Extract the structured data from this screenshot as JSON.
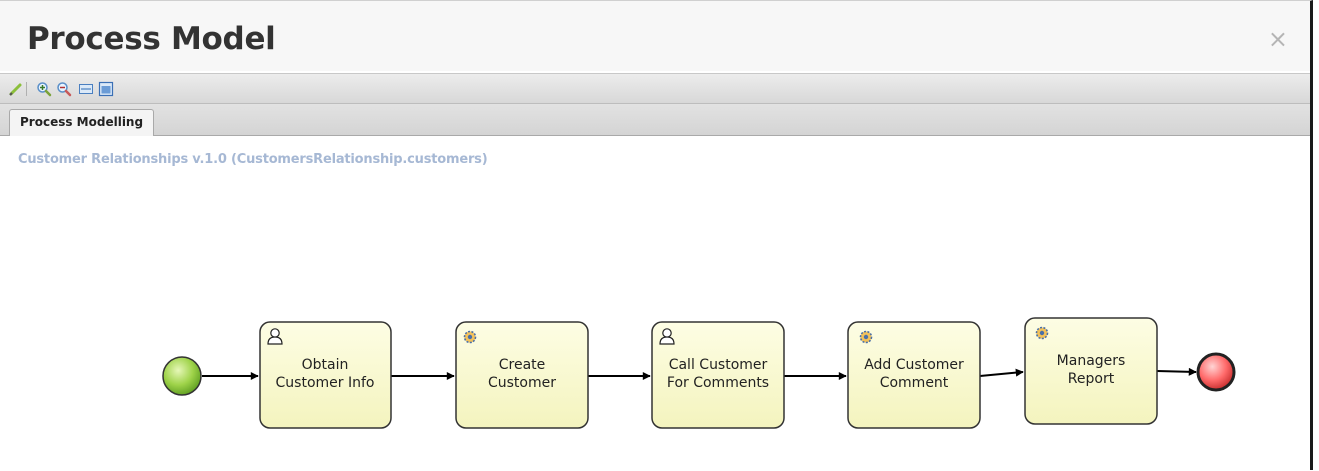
{
  "dialog": {
    "title": "Process Model",
    "close_glyph": "×"
  },
  "toolbar": {
    "buttons": [
      {
        "name": "edit-icon"
      },
      {
        "name": "zoom-in-icon"
      },
      {
        "name": "zoom-out-icon"
      },
      {
        "name": "fit-width-icon"
      },
      {
        "name": "fit-page-icon"
      }
    ]
  },
  "tabs": [
    {
      "label": "Process Modelling",
      "active": true
    }
  ],
  "model": {
    "title": "Customer Relationships v.1.0 (CustomersRelationship.customers)"
  },
  "process": {
    "start_event": {
      "color": "#8cc63f"
    },
    "end_event": {
      "color": "#ff5f5f"
    },
    "tasks": [
      {
        "kind": "user",
        "lines": [
          "Obtain",
          "Customer Info"
        ]
      },
      {
        "kind": "service",
        "lines": [
          "Create",
          "Customer"
        ]
      },
      {
        "kind": "user",
        "lines": [
          "Call Customer",
          "For Comments"
        ]
      },
      {
        "kind": "service",
        "lines": [
          "Add Customer",
          "Comment"
        ]
      },
      {
        "kind": "service",
        "lines": [
          "Managers",
          "Report"
        ]
      }
    ],
    "task_fill": "#fbfbd3"
  }
}
